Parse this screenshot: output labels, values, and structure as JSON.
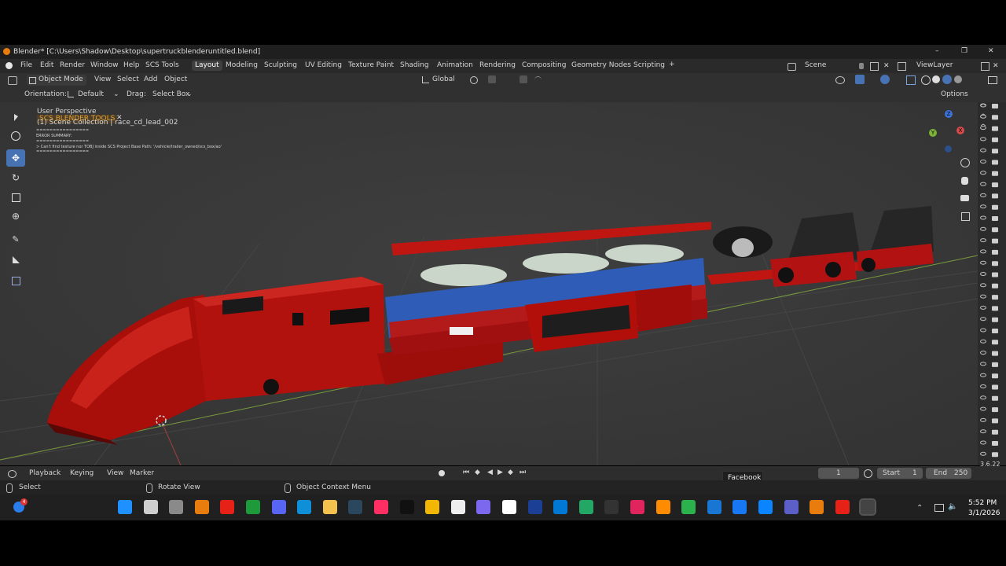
{
  "window": {
    "title": "Blender* [C:\\Users\\Shadow\\Desktop\\supertruckblenderuntitled.blend]",
    "minimize": "–",
    "maximize": "❐",
    "close": "✕"
  },
  "menu": {
    "items": [
      "File",
      "Edit",
      "Render",
      "Window",
      "Help",
      "SCS Tools"
    ],
    "workspaces": [
      "Layout",
      "Modeling",
      "Sculpting",
      "UV Editing",
      "Texture Paint",
      "Shading",
      "Animation",
      "Rendering",
      "Compositing",
      "Geometry Nodes",
      "Scripting"
    ],
    "add_tab": "+",
    "scene": "Scene",
    "view_layer": "ViewLayer"
  },
  "header": {
    "mode": "Object Mode",
    "menus": [
      "View",
      "Select",
      "Add",
      "Object"
    ],
    "transform_orientation": "Global",
    "options": "Options"
  },
  "tool_options": {
    "orientation_label": "Orientation:",
    "orientation_value": "Default",
    "drag_label": "Drag:",
    "drag_value": "Select Box"
  },
  "viewport": {
    "perspective": "User Perspective",
    "scs_tools": "SCS BLENDER TOOLS",
    "collection": "(1) Scene Collection | race_cd_lead_002",
    "error_sep1": "================",
    "error_title": "ERROR SUMMARY:",
    "error_sep2": "================",
    "error_msg": "> Can't find texture nor TOBJ inside SCS Project Base Path: '/vehicle/trailer_owned/scs_box/ao'",
    "error_sep3": "================",
    "gizmo": {
      "x": "X",
      "y": "Y",
      "z": "Z"
    }
  },
  "timeline": {
    "menus": [
      "Playback",
      "Keying",
      "View",
      "Marker"
    ],
    "current_frame": "1",
    "start_label": "Start",
    "start": "1",
    "end_label": "End",
    "end": "250",
    "tooltip": "Facebook"
  },
  "status": {
    "select": "Select",
    "rotate": "Rotate View",
    "context": "Object Context Menu",
    "version": "3.6.22"
  },
  "taskbar": {
    "notification_count": "4",
    "apps": [
      "windows-start",
      "search",
      "task-view",
      "blender",
      "youtube",
      "excel-like",
      "discord",
      "edge",
      "chrome",
      "steam",
      "tiktok-pink",
      "tiktok",
      "file-explorer",
      "pawprint",
      "copilot",
      "notes",
      "paypal",
      "outlook",
      "google-drive",
      "epic-games",
      "pink-app",
      "colorful-app",
      "green-app",
      "blue-app",
      "facebook",
      "store",
      "teams",
      "blender-2",
      "youtube-2",
      "terminal"
    ],
    "time": "5:52 PM",
    "date": "3/1/2026"
  },
  "colors": {
    "accent": "#4772b3",
    "truck_red": "#b3120e",
    "trailer_blue": "#2f5fb8",
    "viewport_bg": "#3a3a3a"
  }
}
